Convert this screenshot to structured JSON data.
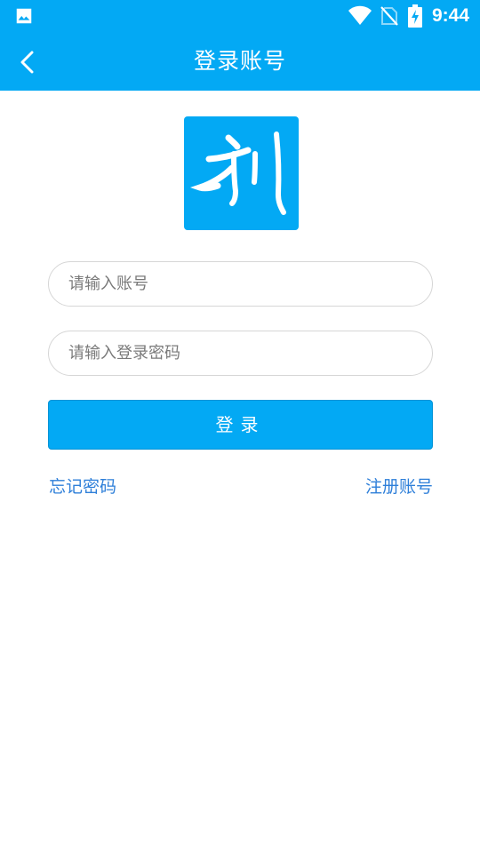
{
  "status_bar": {
    "time": "9:44",
    "icons": [
      "gallery-icon",
      "wifi-icon",
      "no-sim-icon",
      "battery-charging-icon"
    ],
    "background_color": "#03a9f4"
  },
  "app_bar": {
    "title": "登录账号",
    "back_icon": "chevron-left-icon",
    "background_color": "#03a9f4"
  },
  "logo": {
    "glyph": "利",
    "background_color": "#03a9f4"
  },
  "form": {
    "account_placeholder": "请输入账号",
    "account_value": "",
    "password_placeholder": "请输入登录密码",
    "password_value": "",
    "login_label": "登录"
  },
  "links": {
    "forgot_password": "忘记密码",
    "register": "注册账号",
    "color": "#2e7fd9"
  }
}
